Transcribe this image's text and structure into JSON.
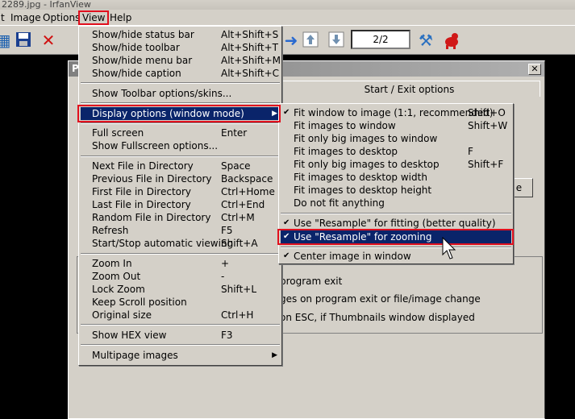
{
  "window": {
    "title": "2289.jpg - IrfanView"
  },
  "menubar": [
    "t",
    "Image",
    "Options",
    "View",
    "Help"
  ],
  "toolbar": {
    "page_indicator": "2/2"
  },
  "background_dialog": {
    "title": "P",
    "tab": "Start / Exit options",
    "close": "✕",
    "button_fragment": "e",
    "lines": [
      "program exit",
      "ges on program exit or file/image change",
      "on ESC, if Thumbnails window displayed"
    ]
  },
  "view_menu": [
    {
      "label": "Show/hide status bar",
      "shortcut": "Alt+Shift+S"
    },
    {
      "label": "Show/hide toolbar",
      "shortcut": "Alt+Shift+T"
    },
    {
      "label": "Show/hide menu bar",
      "shortcut": "Alt+Shift+M"
    },
    {
      "label": "Show/hide caption",
      "shortcut": "Alt+Shift+C"
    },
    {
      "label": "Show Toolbar options/skins..."
    },
    {
      "label": "Display options (window mode)",
      "submenu": true
    },
    {
      "label": "Full screen",
      "shortcut": "Enter"
    },
    {
      "label": "Show Fullscreen options..."
    },
    {
      "label": "Next File in Directory",
      "shortcut": "Space"
    },
    {
      "label": "Previous File in Directory",
      "shortcut": "Backspace"
    },
    {
      "label": "First File in Directory",
      "shortcut": "Ctrl+Home"
    },
    {
      "label": "Last File in Directory",
      "shortcut": "Ctrl+End"
    },
    {
      "label": "Random File in Directory",
      "shortcut": "Ctrl+M"
    },
    {
      "label": "Refresh",
      "shortcut": "F5"
    },
    {
      "label": "Start/Stop automatic viewing",
      "shortcut": "Shift+A"
    },
    {
      "label": "Zoom In",
      "shortcut": "+"
    },
    {
      "label": "Zoom Out",
      "shortcut": "-"
    },
    {
      "label": "Lock Zoom",
      "shortcut": "Shift+L"
    },
    {
      "label": "Keep Scroll position"
    },
    {
      "label": "Original size",
      "shortcut": "Ctrl+H"
    },
    {
      "label": "Show HEX view",
      "shortcut": "F3"
    },
    {
      "label": "Multipage images",
      "submenu": true
    }
  ],
  "display_submenu": [
    {
      "label": "Fit window to image (1:1, recommended)",
      "shortcut": "Shift+O",
      "checked": true
    },
    {
      "label": "Fit images to window",
      "shortcut": "Shift+W"
    },
    {
      "label": "Fit only big images to window"
    },
    {
      "label": "Fit images to desktop",
      "shortcut": "F"
    },
    {
      "label": "Fit only big images to desktop",
      "shortcut": "Shift+F"
    },
    {
      "label": "Fit images to desktop width"
    },
    {
      "label": "Fit images to desktop height"
    },
    {
      "label": "Do not fit anything"
    },
    {
      "label": "Use \"Resample\" for fitting (better quality)",
      "checked": true
    },
    {
      "label": "Use \"Resample\" for zooming",
      "checked": true
    },
    {
      "label": "Center image in window",
      "checked": true
    }
  ],
  "glyphs": {
    "check": "✔",
    "arrow": "▶"
  },
  "colors": {
    "highlight": "#0a246a",
    "callout": "#e1101e",
    "menu_bg": "#d4d0c8"
  }
}
